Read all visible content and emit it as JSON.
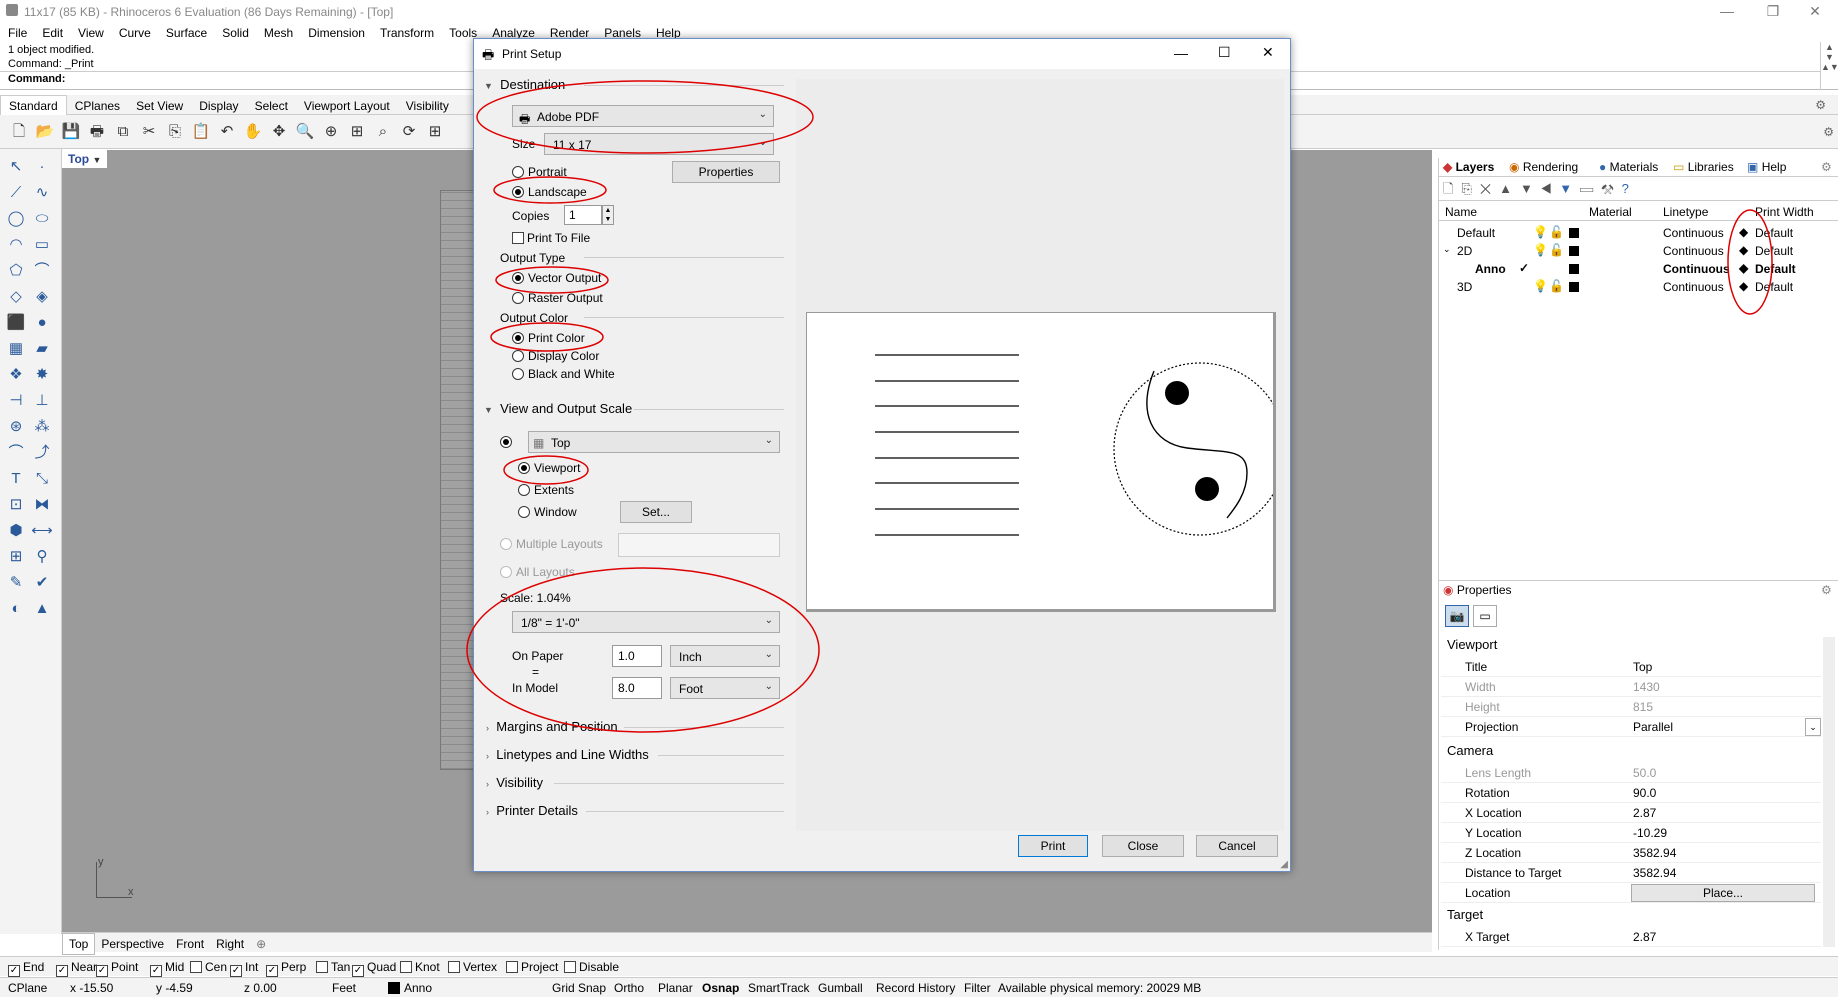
{
  "app": {
    "title": "11x17 (85 KB) - Rhinoceros 6 Evaluation (86 Days Remaining) - [Top]",
    "menu": [
      "File",
      "Edit",
      "View",
      "Curve",
      "Surface",
      "Solid",
      "Mesh",
      "Dimension",
      "Transform",
      "Tools",
      "Analyze",
      "Render",
      "Panels",
      "Help"
    ]
  },
  "command": {
    "history1": "1 object modified.",
    "history2": "Command: _Print",
    "prompt": "Command:"
  },
  "toolbar_tabs": [
    "Standard",
    "CPlanes",
    "Set View",
    "Display",
    "Select",
    "Viewport Layout",
    "Visibility"
  ],
  "viewport": {
    "name": "Top",
    "tabs": [
      "Top",
      "Perspective",
      "Front",
      "Right"
    ],
    "axis_y": "y",
    "axis_x": "x"
  },
  "osnap": [
    {
      "label": "End",
      "checked": true
    },
    {
      "label": "Near",
      "checked": true
    },
    {
      "label": "Point",
      "checked": true
    },
    {
      "label": "Mid",
      "checked": true
    },
    {
      "label": "Cen",
      "checked": false
    },
    {
      "label": "Int",
      "checked": true
    },
    {
      "label": "Perp",
      "checked": true
    },
    {
      "label": "Tan",
      "checked": false
    },
    {
      "label": "Quad",
      "checked": true
    },
    {
      "label": "Knot",
      "checked": false
    },
    {
      "label": "Vertex",
      "checked": false
    },
    {
      "label": "Project",
      "checked": false
    },
    {
      "label": "Disable",
      "checked": false
    }
  ],
  "status": {
    "cplane": "CPlane",
    "x": "x -15.50",
    "y": "y -4.59",
    "z": "z 0.00",
    "units": "Feet",
    "layer": "Anno",
    "items": [
      "Grid Snap",
      "Ortho",
      "Planar",
      "Osnap",
      "SmartTrack",
      "Gumball",
      "Record History",
      "Filter"
    ],
    "memory": "Available physical memory: 20029 MB"
  },
  "layers_panel": {
    "tabs": [
      "Layers",
      "Rendering",
      "Materials",
      "Libraries",
      "Help"
    ],
    "columns": [
      "Name",
      "Material",
      "Linetype",
      "Print Width"
    ],
    "rows": [
      {
        "name": "Default",
        "linetype": "Continuous",
        "width": "Default",
        "current": false
      },
      {
        "name": "2D",
        "linetype": "Continuous",
        "width": "Default",
        "current": false
      },
      {
        "name": "Anno",
        "linetype": "Continuous",
        "width": "Default",
        "current": true
      },
      {
        "name": "3D",
        "linetype": "Continuous",
        "width": "Default",
        "current": false
      }
    ]
  },
  "properties_panel": {
    "title": "Properties",
    "viewport_section": "Viewport",
    "camera_section": "Camera",
    "target_section": "Target",
    "rows": [
      {
        "k": "Title",
        "v": "Top",
        "grey": false
      },
      {
        "k": "Width",
        "v": "1430",
        "grey": true
      },
      {
        "k": "Height",
        "v": "815",
        "grey": true
      },
      {
        "k": "Projection",
        "v": "Parallel",
        "grey": false
      }
    ],
    "camera_rows": [
      {
        "k": "Lens Length",
        "v": "50.0",
        "grey": true
      },
      {
        "k": "Rotation",
        "v": "90.0",
        "grey": false
      },
      {
        "k": "X Location",
        "v": "2.87",
        "grey": false
      },
      {
        "k": "Y Location",
        "v": "-10.29",
        "grey": false
      },
      {
        "k": "Z Location",
        "v": "3582.94",
        "grey": false
      },
      {
        "k": "Distance to Target",
        "v": "3582.94",
        "grey": false
      },
      {
        "k": "Location",
        "v": "Place...",
        "grey": false
      }
    ],
    "target_rows": [
      {
        "k": "X Target",
        "v": "2.87",
        "grey": false
      }
    ]
  },
  "dialog": {
    "title": "Print Setup",
    "destination_header": "Destination",
    "printer": "Adobe PDF",
    "size_label": "Size",
    "size": "11 x 17",
    "portrait": "Portrait",
    "landscape": "Landscape",
    "properties_btn": "Properties",
    "copies_label": "Copies",
    "copies": "1",
    "print_to_file": "Print To File",
    "output_type_label": "Output Type",
    "vector_output": "Vector Output",
    "raster_output": "Raster Output",
    "output_color_label": "Output Color",
    "print_color": "Print Color",
    "display_color": "Display Color",
    "black_white": "Black and White",
    "view_scale_header": "View and Output Scale",
    "view": "Top",
    "viewport": "Viewport",
    "extents": "Extents",
    "window": "Window",
    "set_btn": "Set...",
    "multiple_layouts": "Multiple Layouts",
    "all_layouts": "All Layouts",
    "scale_label": "Scale: 1.04%",
    "scale_preset": "1/8\" = 1'-0\"",
    "on_paper_label": "On Paper",
    "equals": "=",
    "in_model_label": "In Model",
    "on_paper_value": "1.0",
    "on_paper_unit": "Inch",
    "in_model_value": "8.0",
    "in_model_unit": "Foot",
    "collapsed_sections": [
      "Margins and Position",
      "Linetypes and Line Widths",
      "Visibility",
      "Printer Details"
    ],
    "print_btn": "Print",
    "close_btn": "Close",
    "cancel_btn": "Cancel"
  }
}
